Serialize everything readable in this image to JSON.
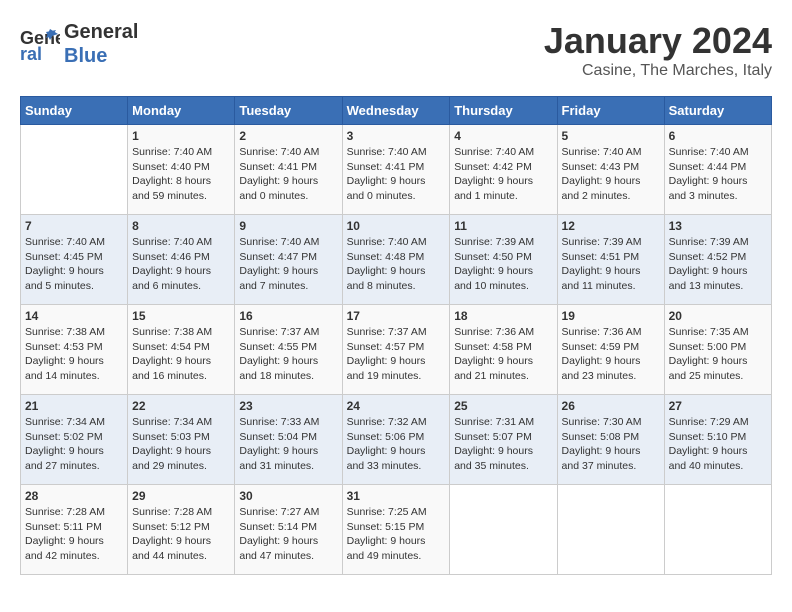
{
  "logo": {
    "line1": "General",
    "line2": "Blue"
  },
  "title": "January 2024",
  "subtitle": "Casine, The Marches, Italy",
  "days_of_week": [
    "Sunday",
    "Monday",
    "Tuesday",
    "Wednesday",
    "Thursday",
    "Friday",
    "Saturday"
  ],
  "weeks": [
    [
      {
        "num": "",
        "info": ""
      },
      {
        "num": "1",
        "info": "Sunrise: 7:40 AM\nSunset: 4:40 PM\nDaylight: 8 hours\nand 59 minutes."
      },
      {
        "num": "2",
        "info": "Sunrise: 7:40 AM\nSunset: 4:41 PM\nDaylight: 9 hours\nand 0 minutes."
      },
      {
        "num": "3",
        "info": "Sunrise: 7:40 AM\nSunset: 4:41 PM\nDaylight: 9 hours\nand 0 minutes."
      },
      {
        "num": "4",
        "info": "Sunrise: 7:40 AM\nSunset: 4:42 PM\nDaylight: 9 hours\nand 1 minute."
      },
      {
        "num": "5",
        "info": "Sunrise: 7:40 AM\nSunset: 4:43 PM\nDaylight: 9 hours\nand 2 minutes."
      },
      {
        "num": "6",
        "info": "Sunrise: 7:40 AM\nSunset: 4:44 PM\nDaylight: 9 hours\nand 3 minutes."
      }
    ],
    [
      {
        "num": "7",
        "info": "Sunrise: 7:40 AM\nSunset: 4:45 PM\nDaylight: 9 hours\nand 5 minutes."
      },
      {
        "num": "8",
        "info": "Sunrise: 7:40 AM\nSunset: 4:46 PM\nDaylight: 9 hours\nand 6 minutes."
      },
      {
        "num": "9",
        "info": "Sunrise: 7:40 AM\nSunset: 4:47 PM\nDaylight: 9 hours\nand 7 minutes."
      },
      {
        "num": "10",
        "info": "Sunrise: 7:40 AM\nSunset: 4:48 PM\nDaylight: 9 hours\nand 8 minutes."
      },
      {
        "num": "11",
        "info": "Sunrise: 7:39 AM\nSunset: 4:50 PM\nDaylight: 9 hours\nand 10 minutes."
      },
      {
        "num": "12",
        "info": "Sunrise: 7:39 AM\nSunset: 4:51 PM\nDaylight: 9 hours\nand 11 minutes."
      },
      {
        "num": "13",
        "info": "Sunrise: 7:39 AM\nSunset: 4:52 PM\nDaylight: 9 hours\nand 13 minutes."
      }
    ],
    [
      {
        "num": "14",
        "info": "Sunrise: 7:38 AM\nSunset: 4:53 PM\nDaylight: 9 hours\nand 14 minutes."
      },
      {
        "num": "15",
        "info": "Sunrise: 7:38 AM\nSunset: 4:54 PM\nDaylight: 9 hours\nand 16 minutes."
      },
      {
        "num": "16",
        "info": "Sunrise: 7:37 AM\nSunset: 4:55 PM\nDaylight: 9 hours\nand 18 minutes."
      },
      {
        "num": "17",
        "info": "Sunrise: 7:37 AM\nSunset: 4:57 PM\nDaylight: 9 hours\nand 19 minutes."
      },
      {
        "num": "18",
        "info": "Sunrise: 7:36 AM\nSunset: 4:58 PM\nDaylight: 9 hours\nand 21 minutes."
      },
      {
        "num": "19",
        "info": "Sunrise: 7:36 AM\nSunset: 4:59 PM\nDaylight: 9 hours\nand 23 minutes."
      },
      {
        "num": "20",
        "info": "Sunrise: 7:35 AM\nSunset: 5:00 PM\nDaylight: 9 hours\nand 25 minutes."
      }
    ],
    [
      {
        "num": "21",
        "info": "Sunrise: 7:34 AM\nSunset: 5:02 PM\nDaylight: 9 hours\nand 27 minutes."
      },
      {
        "num": "22",
        "info": "Sunrise: 7:34 AM\nSunset: 5:03 PM\nDaylight: 9 hours\nand 29 minutes."
      },
      {
        "num": "23",
        "info": "Sunrise: 7:33 AM\nSunset: 5:04 PM\nDaylight: 9 hours\nand 31 minutes."
      },
      {
        "num": "24",
        "info": "Sunrise: 7:32 AM\nSunset: 5:06 PM\nDaylight: 9 hours\nand 33 minutes."
      },
      {
        "num": "25",
        "info": "Sunrise: 7:31 AM\nSunset: 5:07 PM\nDaylight: 9 hours\nand 35 minutes."
      },
      {
        "num": "26",
        "info": "Sunrise: 7:30 AM\nSunset: 5:08 PM\nDaylight: 9 hours\nand 37 minutes."
      },
      {
        "num": "27",
        "info": "Sunrise: 7:29 AM\nSunset: 5:10 PM\nDaylight: 9 hours\nand 40 minutes."
      }
    ],
    [
      {
        "num": "28",
        "info": "Sunrise: 7:28 AM\nSunset: 5:11 PM\nDaylight: 9 hours\nand 42 minutes."
      },
      {
        "num": "29",
        "info": "Sunrise: 7:28 AM\nSunset: 5:12 PM\nDaylight: 9 hours\nand 44 minutes."
      },
      {
        "num": "30",
        "info": "Sunrise: 7:27 AM\nSunset: 5:14 PM\nDaylight: 9 hours\nand 47 minutes."
      },
      {
        "num": "31",
        "info": "Sunrise: 7:25 AM\nSunset: 5:15 PM\nDaylight: 9 hours\nand 49 minutes."
      },
      {
        "num": "",
        "info": ""
      },
      {
        "num": "",
        "info": ""
      },
      {
        "num": "",
        "info": ""
      }
    ]
  ]
}
